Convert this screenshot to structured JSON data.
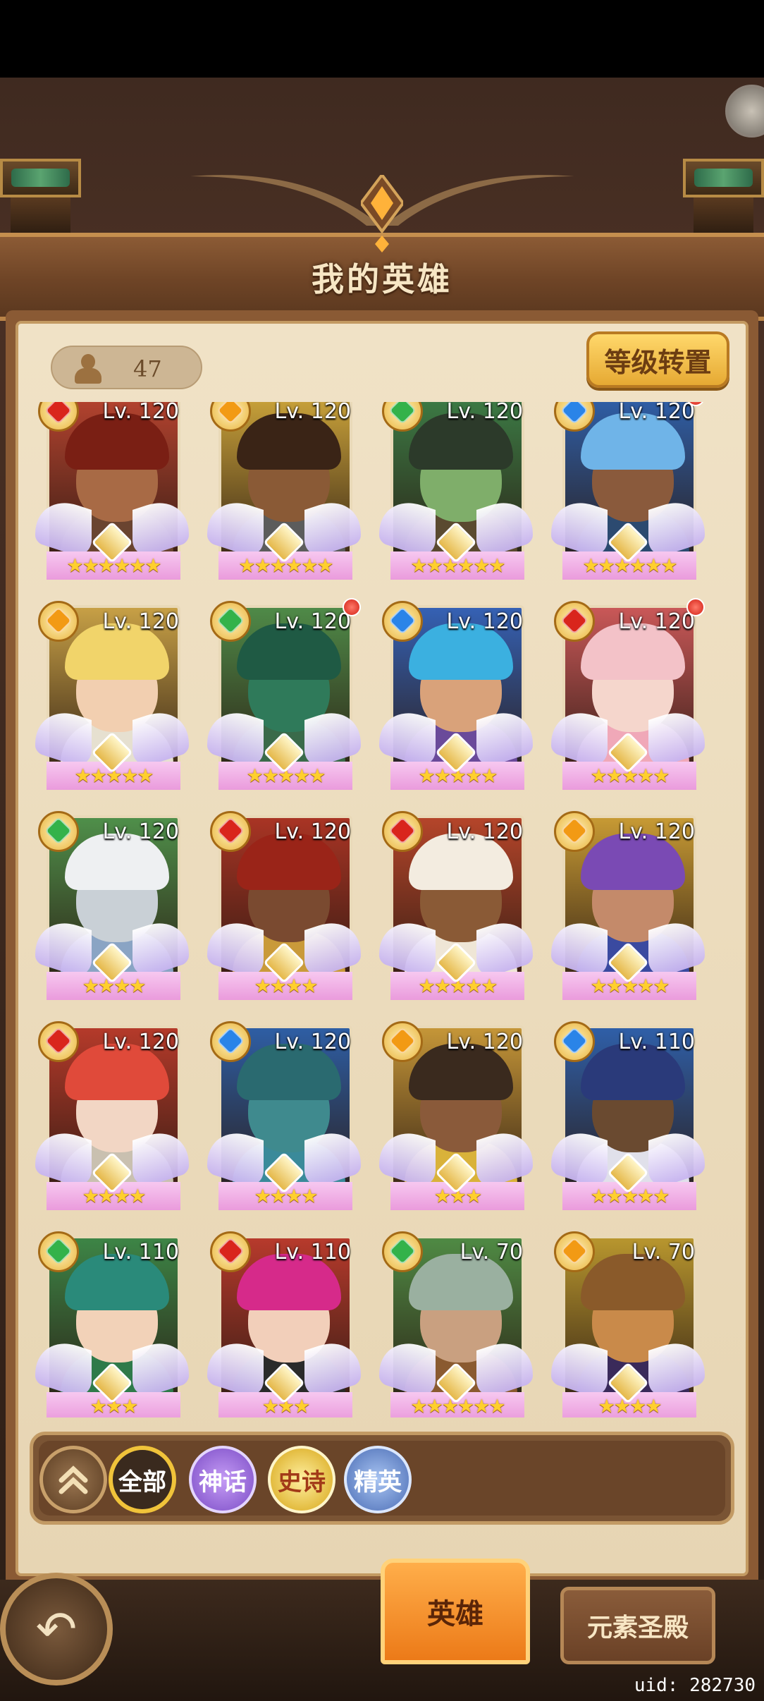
{
  "header": {
    "title": "我的英雄"
  },
  "toolbar": {
    "hero_count": "47",
    "reset_level_label": "等级转置"
  },
  "colors": {
    "fire": "#d9251c",
    "water": "#2a84e8",
    "nature": "#33b24a",
    "light": "#f29a14"
  },
  "heroes": [
    {
      "level": "Lv. 120",
      "stars": "★★★★★★",
      "element": "fire",
      "bg": "#b5432f",
      "skin": "#a86a45",
      "hair": "#7a1f14",
      "body": "#6a4430",
      "red_dot": false
    },
    {
      "level": "Lv. 120",
      "stars": "★★★★★★",
      "element": "light",
      "bg": "#c9a23a",
      "skin": "#8a5a36",
      "hair": "#3a2416",
      "body": "#5c5c5c",
      "red_dot": false
    },
    {
      "level": "Lv. 120",
      "stars": "★★★★★★",
      "element": "nature",
      "bg": "#3c7b45",
      "skin": "#7fae6a",
      "hair": "#2c3a2a",
      "body": "#5a4a30",
      "red_dot": false
    },
    {
      "level": "Lv. 120",
      "stars": "★★★★★★",
      "element": "water",
      "bg": "#2f5fa8",
      "skin": "#8a5a3c",
      "hair": "#6fb4e8",
      "body": "#2c4a70",
      "red_dot": true
    },
    {
      "level": "Lv. 120",
      "stars": "★★★★★",
      "element": "light",
      "bg": "#c7a046",
      "skin": "#f2cfb0",
      "hair": "#f1d46a",
      "body": "#e6e0d0",
      "red_dot": false
    },
    {
      "level": "Lv. 120",
      "stars": "★★★★★",
      "element": "nature",
      "bg": "#4f8a48",
      "skin": "#2f7a5a",
      "hair": "#1f5a44",
      "body": "#3a6a4a",
      "red_dot": true
    },
    {
      "level": "Lv. 120",
      "stars": "★★★★★",
      "element": "water",
      "bg": "#3561b4",
      "skin": "#d9a27a",
      "hair": "#3bb0e0",
      "body": "#6a4a9a",
      "red_dot": false
    },
    {
      "level": "Lv. 120",
      "stars": "★★★★★",
      "element": "fire",
      "bg": "#c95858",
      "skin": "#f5d6cc",
      "hair": "#f3c2c8",
      "body": "#f0a8b8",
      "red_dot": true
    },
    {
      "level": "Lv. 120",
      "stars": "★★★★",
      "element": "nature",
      "bg": "#4f8f4a",
      "skin": "#c9d0d6",
      "hair": "#eef0f2",
      "body": "#8aa4c4",
      "red_dot": false
    },
    {
      "level": "Lv. 120",
      "stars": "★★★★",
      "element": "fire",
      "bg": "#a93424",
      "skin": "#7a4a30",
      "hair": "#9a2418",
      "body": "#c99a3a",
      "red_dot": false
    },
    {
      "level": "Lv. 120",
      "stars": "★★★★★",
      "element": "fire",
      "bg": "#b5452a",
      "skin": "#8a5a36",
      "hair": "#f3ece0",
      "body": "#efe6d6",
      "red_dot": false
    },
    {
      "level": "Lv. 120",
      "stars": "★★★★★",
      "element": "light",
      "bg": "#c79a34",
      "skin": "#c48a6a",
      "hair": "#7a4ab4",
      "body": "#3a4aa0",
      "red_dot": false
    },
    {
      "level": "Lv. 120",
      "stars": "★★★★",
      "element": "fire",
      "bg": "#b53a2a",
      "skin": "#f2d6c4",
      "hair": "#e04a3a",
      "body": "#c9c0b0",
      "red_dot": false
    },
    {
      "level": "Lv. 120",
      "stars": "★★★★",
      "element": "water",
      "bg": "#2e5ea4",
      "skin": "#3f8a8e",
      "hair": "#2a6a70",
      "body": "#3a8a9a",
      "red_dot": false
    },
    {
      "level": "Lv. 120",
      "stars": "★★★",
      "element": "light",
      "bg": "#c59638",
      "skin": "#8a5a3a",
      "hair": "#3a2a1e",
      "body": "#d9b23a",
      "red_dot": false
    },
    {
      "level": "Lv. 110",
      "stars": "★★★★★",
      "element": "water",
      "bg": "#2f5fa8",
      "skin": "#6a4a30",
      "hair": "#2a3a7a",
      "body": "#e0e0ea",
      "red_dot": false
    },
    {
      "level": "Lv. 110",
      "stars": "★★★",
      "element": "nature",
      "bg": "#3d8546",
      "skin": "#f2d2b8",
      "hair": "#2a8a7a",
      "body": "#2f7a4a",
      "red_dot": false
    },
    {
      "level": "Lv. 110",
      "stars": "★★★",
      "element": "fire",
      "bg": "#b73a2c",
      "skin": "#f2cfba",
      "hair": "#d62a8a",
      "body": "#2a2a2a",
      "red_dot": false
    },
    {
      "level": "Lv. 70",
      "stars": "★★★★★★",
      "element": "nature",
      "bg": "#4f8a44",
      "skin": "#c9a080",
      "hair": "#9ab0a0",
      "body": "#8a5a30",
      "red_dot": false
    },
    {
      "level": "Lv. 70",
      "stars": "★★★★",
      "element": "light",
      "bg": "#b8962e",
      "skin": "#c98a4a",
      "hair": "#8a5a2a",
      "body": "#3a2a5a",
      "red_dot": false
    }
  ],
  "filters": {
    "all": "全部",
    "myth": "神话",
    "epic": "史诗",
    "elite": "精英"
  },
  "tabs": {
    "heroes": "英雄",
    "temple": "元素圣殿"
  },
  "footer": {
    "uid": "uid: 282730"
  }
}
